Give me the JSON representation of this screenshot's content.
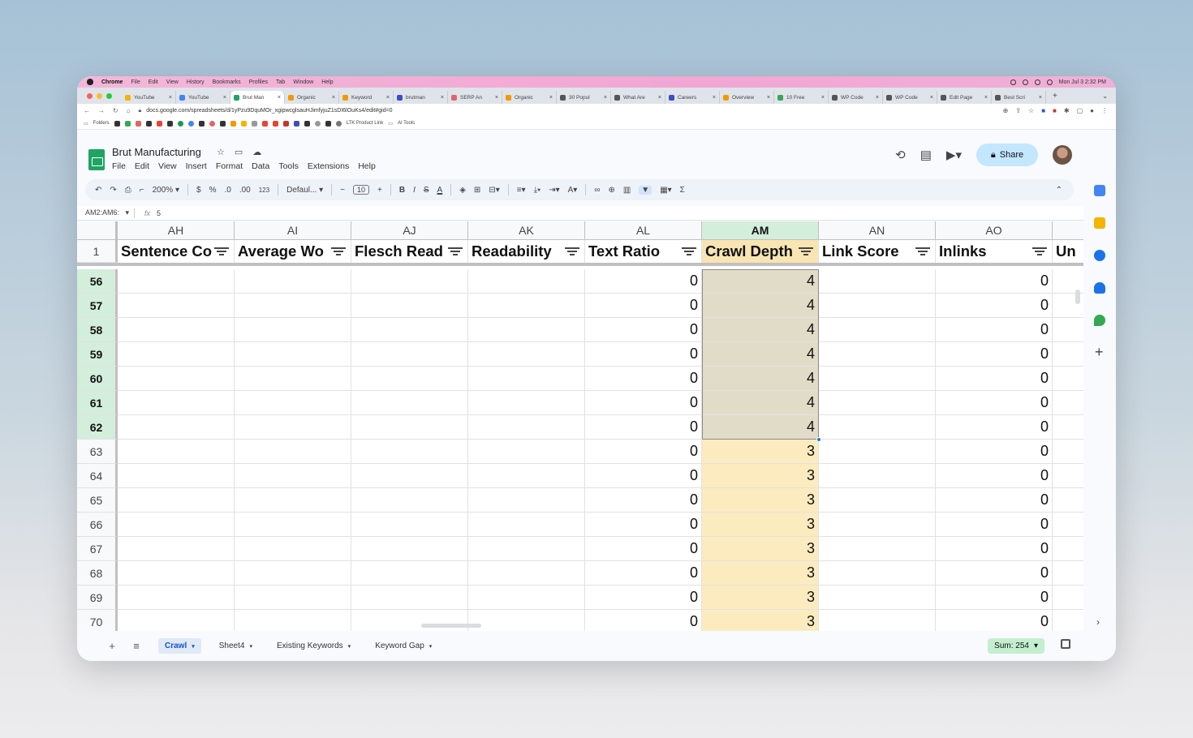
{
  "menubar": {
    "app": "Chrome",
    "items": [
      "File",
      "Edit",
      "View",
      "History",
      "Bookmarks",
      "Profiles",
      "Tab",
      "Window",
      "Help"
    ],
    "clock": "Mon Jul 3  2:32 PM"
  },
  "tabs": [
    {
      "label": "YouTube",
      "color": "#f4b400",
      "active": false
    },
    {
      "label": "YouTube",
      "color": "#4285f4",
      "active": false
    },
    {
      "label": "Brut Man",
      "color": "#1fa463",
      "active": true
    },
    {
      "label": "Organic",
      "color": "#f29900",
      "active": false
    },
    {
      "label": "Keyword",
      "color": "#f29900",
      "active": false
    },
    {
      "label": "brutman",
      "color": "#3c4fbf",
      "active": false
    },
    {
      "label": "SERP An",
      "color": "#e06666",
      "active": false
    },
    {
      "label": "Organic",
      "color": "#f29900",
      "active": false
    },
    {
      "label": "30 Popul",
      "color": "#555555",
      "active": false
    },
    {
      "label": "What Are",
      "color": "#555555",
      "active": false
    },
    {
      "label": "Careers",
      "color": "#3c4fbf",
      "active": false
    },
    {
      "label": "Overview",
      "color": "#f29900",
      "active": false
    },
    {
      "label": "10 Free",
      "color": "#34a853",
      "active": false
    },
    {
      "label": "WP Code",
      "color": "#555555",
      "active": false
    },
    {
      "label": "WP Code",
      "color": "#555555",
      "active": false
    },
    {
      "label": "Edit Page",
      "color": "#555555",
      "active": false
    },
    {
      "label": "Best Scri",
      "color": "#555555",
      "active": false
    }
  ],
  "address": {
    "url": "docs.google.com/spreadsheets/d/1yPzu9DquMOr_xgipwcglsauHJimfyjuZ1sDI6lOuKs4/edit#gid=0"
  },
  "bookmarks": {
    "folders": "Folders",
    "ltk": "LTK Product Link",
    "ai": "AI Tools"
  },
  "doc": {
    "title": "Brut Manufacturing",
    "menus": [
      "File",
      "Edit",
      "View",
      "Insert",
      "Format",
      "Data",
      "Tools",
      "Extensions",
      "Help"
    ],
    "share": "Share"
  },
  "toolbar": {
    "zoom": "200%",
    "currency": "$",
    "percent": "%",
    "dec_decrease": ".0",
    "dec_increase": ".00",
    "format_123": "123",
    "font": "Defaul...",
    "font_size": "10",
    "bold": "B",
    "italic": "I",
    "strike": "S",
    "text_color": "A",
    "sigma": "Σ"
  },
  "formula_bar": {
    "namebox": "AM2:AM6:",
    "fx": "fx",
    "value": "5"
  },
  "grid": {
    "columns": [
      "AH",
      "AI",
      "AJ",
      "AK",
      "AL",
      "AM",
      "AN",
      "AO"
    ],
    "selected_column": "AM",
    "header_row_number": "1",
    "headers": [
      "Sentence Co",
      "Average Wo",
      "Flesch Read",
      "Readability",
      "Text Ratio",
      "Crawl Depth",
      "Link Score",
      "Inlinks",
      "Un"
    ],
    "rows": [
      {
        "n": "56",
        "text_ratio": "0",
        "crawl_depth": "4",
        "inlinks": "0",
        "selected": true
      },
      {
        "n": "57",
        "text_ratio": "0",
        "crawl_depth": "4",
        "inlinks": "0",
        "selected": true
      },
      {
        "n": "58",
        "text_ratio": "0",
        "crawl_depth": "4",
        "inlinks": "0",
        "selected": true
      },
      {
        "n": "59",
        "text_ratio": "0",
        "crawl_depth": "4",
        "inlinks": "0",
        "selected": true
      },
      {
        "n": "60",
        "text_ratio": "0",
        "crawl_depth": "4",
        "inlinks": "0",
        "selected": true
      },
      {
        "n": "61",
        "text_ratio": "0",
        "crawl_depth": "4",
        "inlinks": "0",
        "selected": true
      },
      {
        "n": "62",
        "text_ratio": "0",
        "crawl_depth": "4",
        "inlinks": "0",
        "selected": true
      },
      {
        "n": "63",
        "text_ratio": "0",
        "crawl_depth": "3",
        "inlinks": "0",
        "selected": false
      },
      {
        "n": "64",
        "text_ratio": "0",
        "crawl_depth": "3",
        "inlinks": "0",
        "selected": false
      },
      {
        "n": "65",
        "text_ratio": "0",
        "crawl_depth": "3",
        "inlinks": "0",
        "selected": false
      },
      {
        "n": "66",
        "text_ratio": "0",
        "crawl_depth": "3",
        "inlinks": "0",
        "selected": false
      },
      {
        "n": "67",
        "text_ratio": "0",
        "crawl_depth": "3",
        "inlinks": "0",
        "selected": false
      },
      {
        "n": "68",
        "text_ratio": "0",
        "crawl_depth": "3",
        "inlinks": "0",
        "selected": false
      },
      {
        "n": "69",
        "text_ratio": "0",
        "crawl_depth": "3",
        "inlinks": "0",
        "selected": false
      },
      {
        "n": "70",
        "text_ratio": "0",
        "crawl_depth": "3",
        "inlinks": "0",
        "selected": false
      }
    ]
  },
  "sheets": {
    "tabs": [
      "Crawl",
      "Sheet4",
      "Existing Keywords",
      "Keyword Gap"
    ],
    "active": "Crawl",
    "sum": "Sum: 254"
  },
  "colors": {
    "selection_fill": "#e0dcc8",
    "highlight_fill": "#fbebbf",
    "selected_header": "#d3eedb",
    "share_button": "#c2e7ff"
  }
}
